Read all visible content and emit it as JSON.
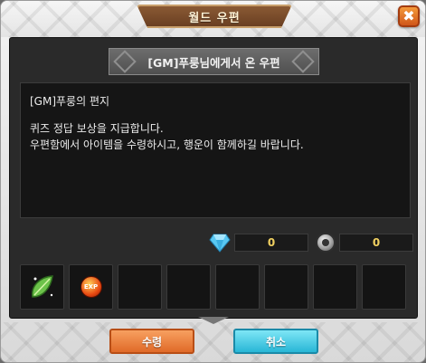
{
  "window": {
    "title": "월드 우편",
    "close_label": "✖"
  },
  "mail": {
    "sender_header": "[GM]푸룽님에게서 온 우편",
    "letter_title": "[GM]푸룽의 편지",
    "letter_lines": [
      "퀴즈 정답 보상을 지급합니다.",
      "우편함에서 아이템을 수령하시고, 행운이 함께하길 바랍니다."
    ]
  },
  "currency": {
    "gem": {
      "icon": "diamond-gem-icon",
      "value": "0",
      "color": "#59c8f2"
    },
    "coin": {
      "icon": "coin-icon",
      "value": "0",
      "color": "#c8c8c8"
    }
  },
  "attachments": [
    {
      "slot": 1,
      "icon": "green-leaf-item-icon"
    },
    {
      "slot": 2,
      "icon": "exp-potion-item-icon",
      "badge": "EXP"
    },
    {
      "slot": 3
    },
    {
      "slot": 4
    },
    {
      "slot": 5
    },
    {
      "slot": 6
    },
    {
      "slot": 7
    },
    {
      "slot": 8
    }
  ],
  "buttons": {
    "receive_label": "수령",
    "cancel_label": "취소"
  },
  "colors": {
    "receive_button": "#e8793a",
    "cancel_button": "#3cc3e0",
    "title_tab": "#7a4a2a",
    "close_button": "#e06a28"
  }
}
